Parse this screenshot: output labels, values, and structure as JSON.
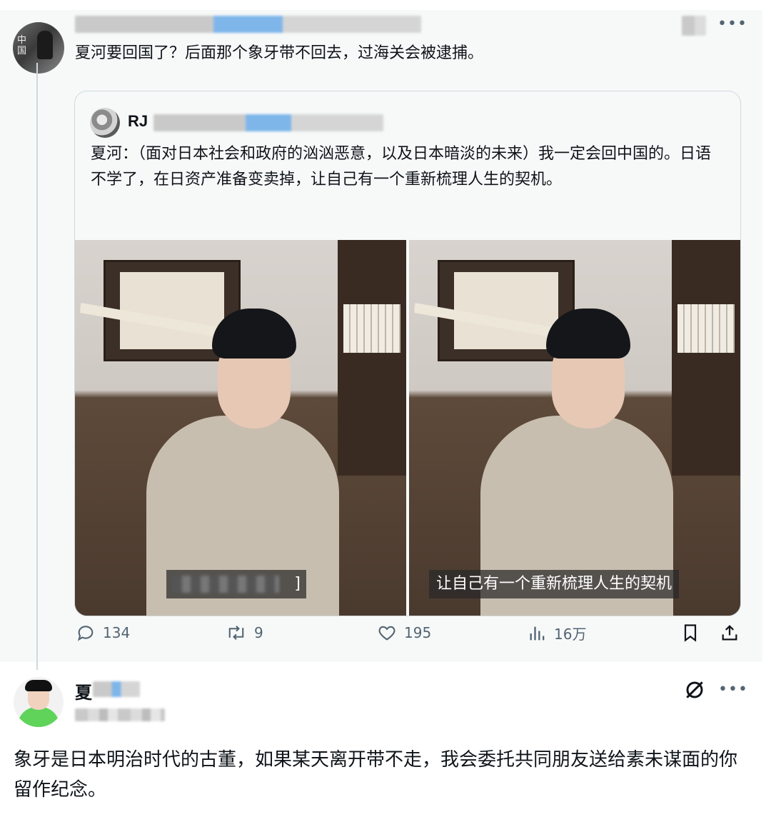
{
  "parent_tweet": {
    "text": "夏河要回国了？后面那个象牙带不回去，过海关会被逮捕。"
  },
  "quoted_tweet": {
    "author_name": "RJ",
    "text": "夏河：（面对日本社会和政府的汹汹恶意，以及日本暗淡的未来）我一定会回中国的。日语不学了，在日资产准备变卖掉，让自己有一个重新梳理人生的契机。",
    "media": [
      {
        "subtitle_visible": "]"
      },
      {
        "subtitle": "让自己有一个重新梳理人生的契机"
      }
    ]
  },
  "actions": {
    "reply_count": "134",
    "retweet_count": "9",
    "like_count": "195",
    "view_count": "16万",
    "icons": [
      "reply-icon",
      "retweet-icon",
      "like-icon",
      "views-icon",
      "bookmark-icon",
      "share-icon"
    ]
  },
  "reply_tweet": {
    "author_name_visible": "夏",
    "text": "象牙是日本明治时代的古董，如果某天离开带不走，我会委托共同朋友送给素未谋面的你留作纪念。"
  },
  "colors": {
    "text": "#0f1419",
    "secondary": "#536471",
    "border": "#cfd9de",
    "highlight_bg": "#f7f9f9"
  }
}
